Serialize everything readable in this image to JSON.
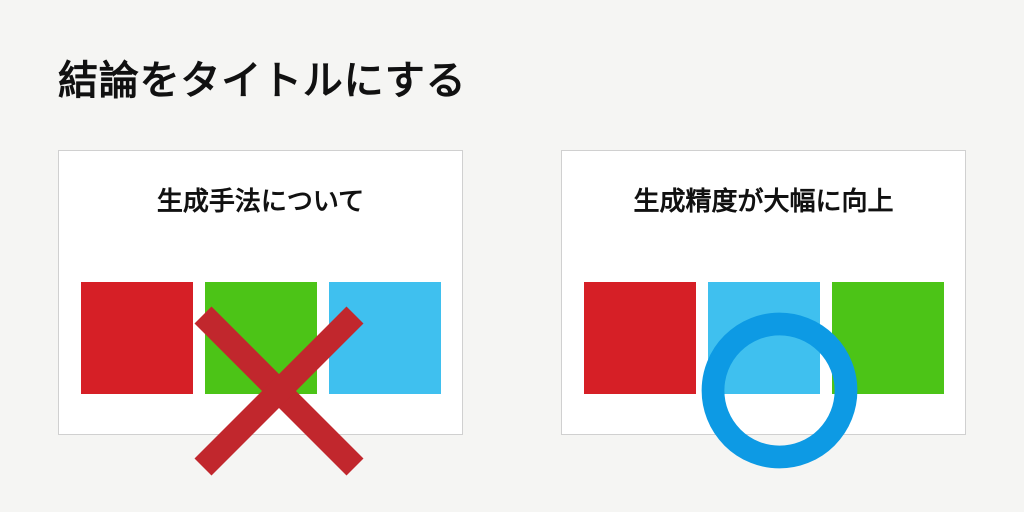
{
  "title": "結論をタイトルにする",
  "panels": {
    "bad": {
      "title": "生成手法について",
      "blocks": [
        {
          "color": "#d61f26"
        },
        {
          "color": "#4cc417"
        },
        {
          "color": "#3fc0ef"
        }
      ],
      "markColor": "#c1272d"
    },
    "good": {
      "title": "生成精度が大幅に向上",
      "blocks": [
        {
          "color": "#d61f26"
        },
        {
          "color": "#3fc0ef"
        },
        {
          "color": "#4cc417"
        }
      ],
      "markColor": "#0d9ae4"
    }
  }
}
